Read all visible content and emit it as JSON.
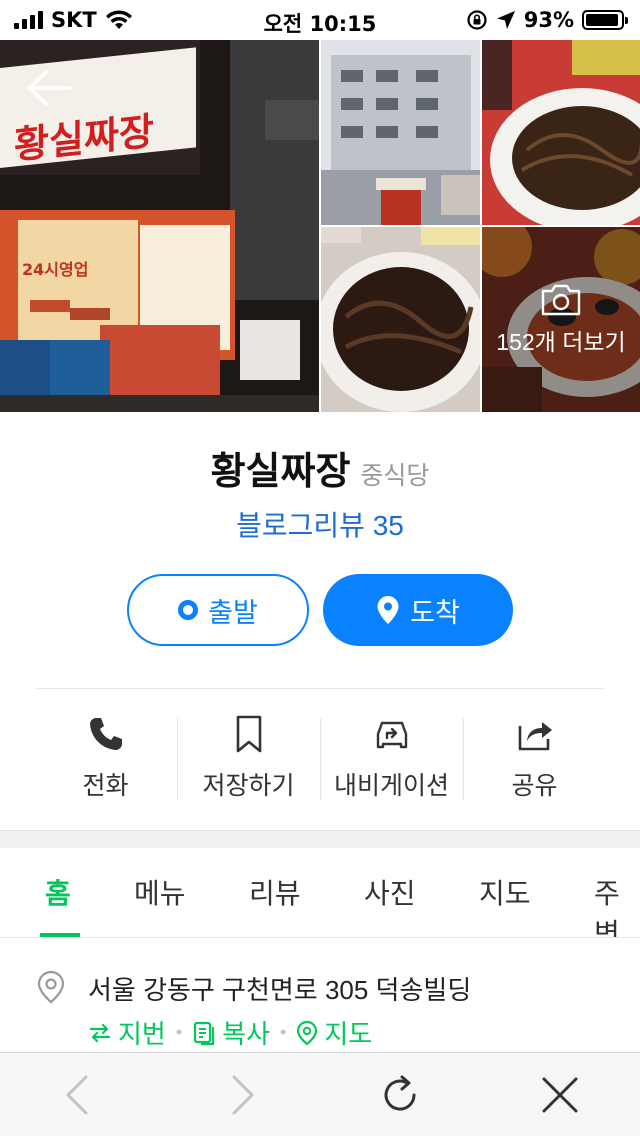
{
  "status_bar": {
    "carrier": "SKT",
    "time": "오전 10:15",
    "battery": "93%",
    "battery_level": 0.93,
    "icons": [
      "signal-icon",
      "wifi-icon",
      "rotation-lock-icon",
      "location-arrow-icon",
      "battery-icon"
    ]
  },
  "gallery": {
    "more_label": "152개 더보기",
    "sign_text": "황실짜장",
    "shop_text": "24시영업"
  },
  "place": {
    "name": "황실짜장",
    "category": "중식당",
    "blog_review": "블로그리뷰 35"
  },
  "route": {
    "depart_label": "출발",
    "arrive_label": "도착",
    "accent": "#0a82ff"
  },
  "actions": [
    {
      "label": "전화",
      "icon": "phone-icon"
    },
    {
      "label": "저장하기",
      "icon": "bookmark-icon"
    },
    {
      "label": "내비게이션",
      "icon": "navigation-car-icon"
    },
    {
      "label": "공유",
      "icon": "share-icon"
    }
  ],
  "tabs": [
    {
      "label": "홈",
      "active": true
    },
    {
      "label": "메뉴"
    },
    {
      "label": "리뷰"
    },
    {
      "label": "사진"
    },
    {
      "label": "지도"
    },
    {
      "label": "주변"
    }
  ],
  "address": {
    "text": "서울 강동구 구천면로 305 덕송빌딩",
    "links": [
      "지번",
      "복사",
      "지도"
    ],
    "link_color": "#03c75a"
  },
  "toolbar": {
    "icons": [
      "back-arrow-icon",
      "forward-arrow-icon",
      "reload-icon",
      "close-icon"
    ]
  }
}
